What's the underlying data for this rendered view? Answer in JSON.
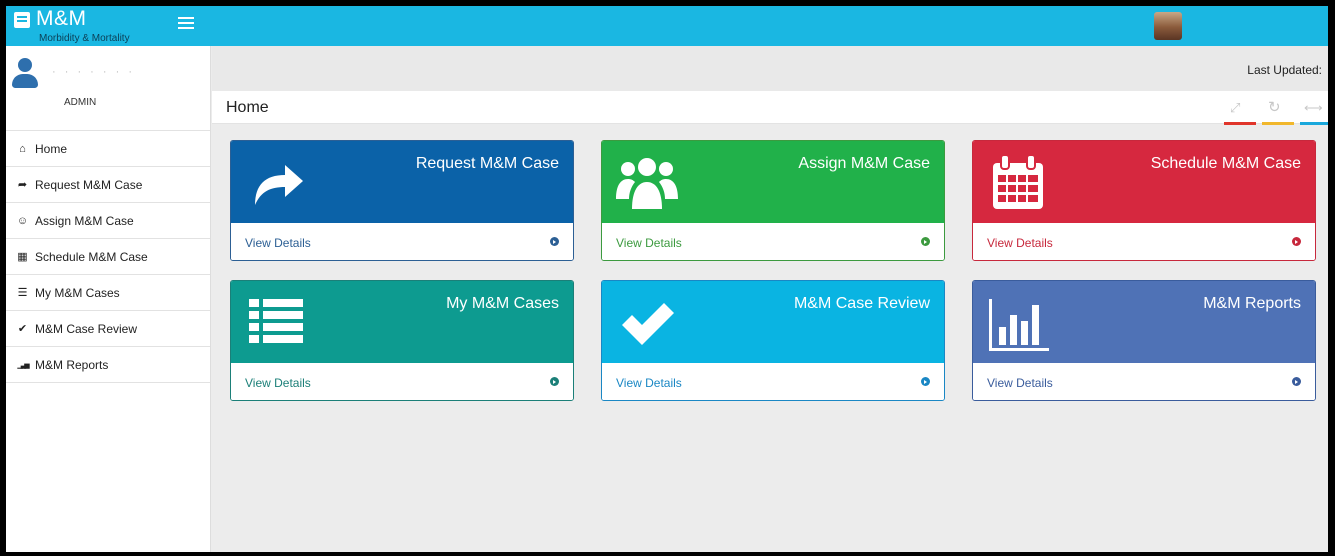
{
  "app": {
    "title": "M&M",
    "subtitle": "Morbidity & Mortality",
    "user_name": "· · ·   · · · ·",
    "user_role": "ADMIN"
  },
  "header": {
    "last_updated_label": "Last Updated:",
    "page_title": "Home"
  },
  "tools": {
    "fullscreen": "⤢",
    "refresh": "↻",
    "collapse": "⟷"
  },
  "sidebar": {
    "items": [
      {
        "label": "Home",
        "icon": "home-icon",
        "glyph": "⌂"
      },
      {
        "label": "Request M&M Case",
        "icon": "share-arrow-icon",
        "glyph": "➦"
      },
      {
        "label": "Assign M&M Case",
        "icon": "users-icon",
        "glyph": "☺"
      },
      {
        "label": "Schedule M&M Case",
        "icon": "calendar-icon",
        "glyph": "▦"
      },
      {
        "label": "My M&M Cases",
        "icon": "list-icon",
        "glyph": "☰"
      },
      {
        "label": "M&M Case Review",
        "icon": "check-icon",
        "glyph": "✔"
      },
      {
        "label": "M&M Reports",
        "icon": "bar-chart-icon",
        "glyph": "▁▃▅"
      }
    ]
  },
  "tiles": [
    {
      "title": "Request M&M Case",
      "link": "View Details",
      "icon": "share-arrow-icon",
      "color": "#0b62a8",
      "foot_color": "#2c5f94"
    },
    {
      "title": "Assign M&M Case",
      "link": "View Details",
      "icon": "users-icon",
      "color": "#21b14a",
      "foot_color": "#3c9a3f"
    },
    {
      "title": "Schedule M&M Case",
      "link": "View Details",
      "icon": "calendar-icon",
      "color": "#d6283f",
      "foot_color": "#c7283c"
    },
    {
      "title": "My M&M Cases",
      "link": "View Details",
      "icon": "list-icon",
      "color": "#0d9b90",
      "foot_color": "#1b7f78"
    },
    {
      "title": "M&M Case Review",
      "link": "View Details",
      "icon": "check-icon",
      "color": "#0ab4e2",
      "foot_color": "#1a87c4"
    },
    {
      "title": "M&M Reports",
      "link": "View Details",
      "icon": "bar-chart-icon",
      "color": "#4f72b6",
      "foot_color": "#3a5c9c"
    }
  ],
  "colors": {
    "topbar": "#1ab7e2",
    "accent_red": "#e0352b",
    "accent_yellow": "#f1b72c",
    "accent_blue": "#1aa8dc"
  }
}
